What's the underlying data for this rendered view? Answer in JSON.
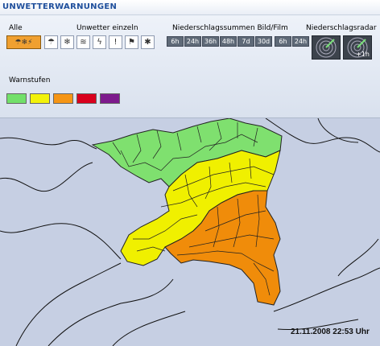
{
  "header": {
    "title": "UNWETTERWARNUNGEN"
  },
  "toolbar": {
    "alle_label": "Alle",
    "einzeln_label": "Unwetter einzeln",
    "niederschlag_label": "Niederschlagssummen Bild/Film",
    "radar_label": "Niederschlagsradar",
    "einzeln_icons": [
      "rain-icon",
      "snow-icon",
      "storm-icon",
      "thunderstorm-icon",
      "black-ice-icon",
      "fog-icon",
      "wind-icon"
    ],
    "summen_buttons": [
      "6h",
      "24h",
      "36h",
      "48h",
      "7d",
      "30d"
    ],
    "summen_film_buttons": [
      "6h",
      "24h"
    ],
    "radar_plus": "+1h"
  },
  "legend": {
    "label": "Warnstufen",
    "levels": [
      {
        "color": "#72e06a"
      },
      {
        "color": "#f2f20a"
      },
      {
        "color": "#f59515"
      },
      {
        "color": "#d9001d"
      },
      {
        "color": "#7d1a8c"
      }
    ]
  },
  "map": {
    "colors": {
      "background": "#c6cfe3",
      "green": "#7fe06f",
      "yellow": "#f0f000",
      "orange": "#f08c0a"
    },
    "timestamp": "21.11.2008 22:53 Uhr"
  }
}
